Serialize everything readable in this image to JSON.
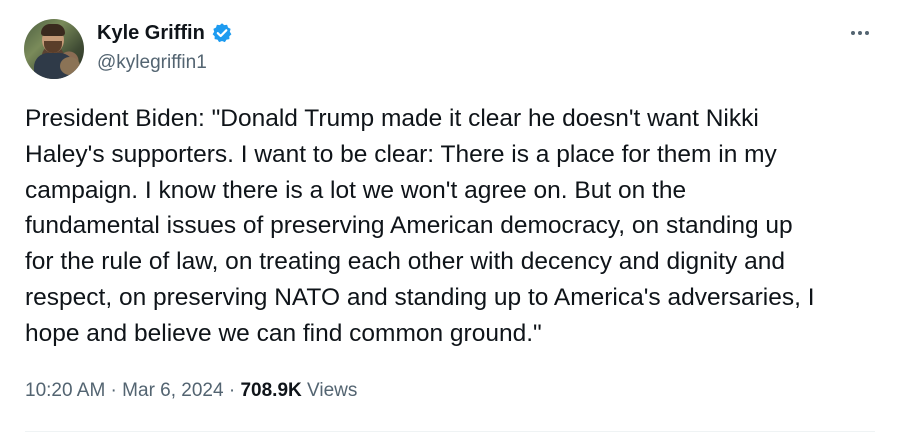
{
  "author": {
    "display_name": "Kyle Griffin",
    "handle": "@kylegriffin1",
    "verified_badge_color": "#1d9bf0"
  },
  "tweet": {
    "text": "President Biden: \"Donald Trump made it clear he doesn't want Nikki\nHaley's supporters. I want to be clear: There is a place for them in my\ncampaign. I know there is a lot we won't agree on. But on the\nfundamental issues of preserving American democracy, on standing up\nfor the rule of law, on treating each other with decency and dignity and\nrespect, on preserving NATO and standing up to America's adversaries, I\nhope and believe we can find common ground.\""
  },
  "meta": {
    "time": "10:20 AM",
    "separator": " · ",
    "date": "Mar 6, 2024",
    "views_count": "708.9K",
    "views_label": " Views"
  },
  "icons": {
    "verified": "verified-badge-icon",
    "more": "more-horizontal-icon"
  }
}
